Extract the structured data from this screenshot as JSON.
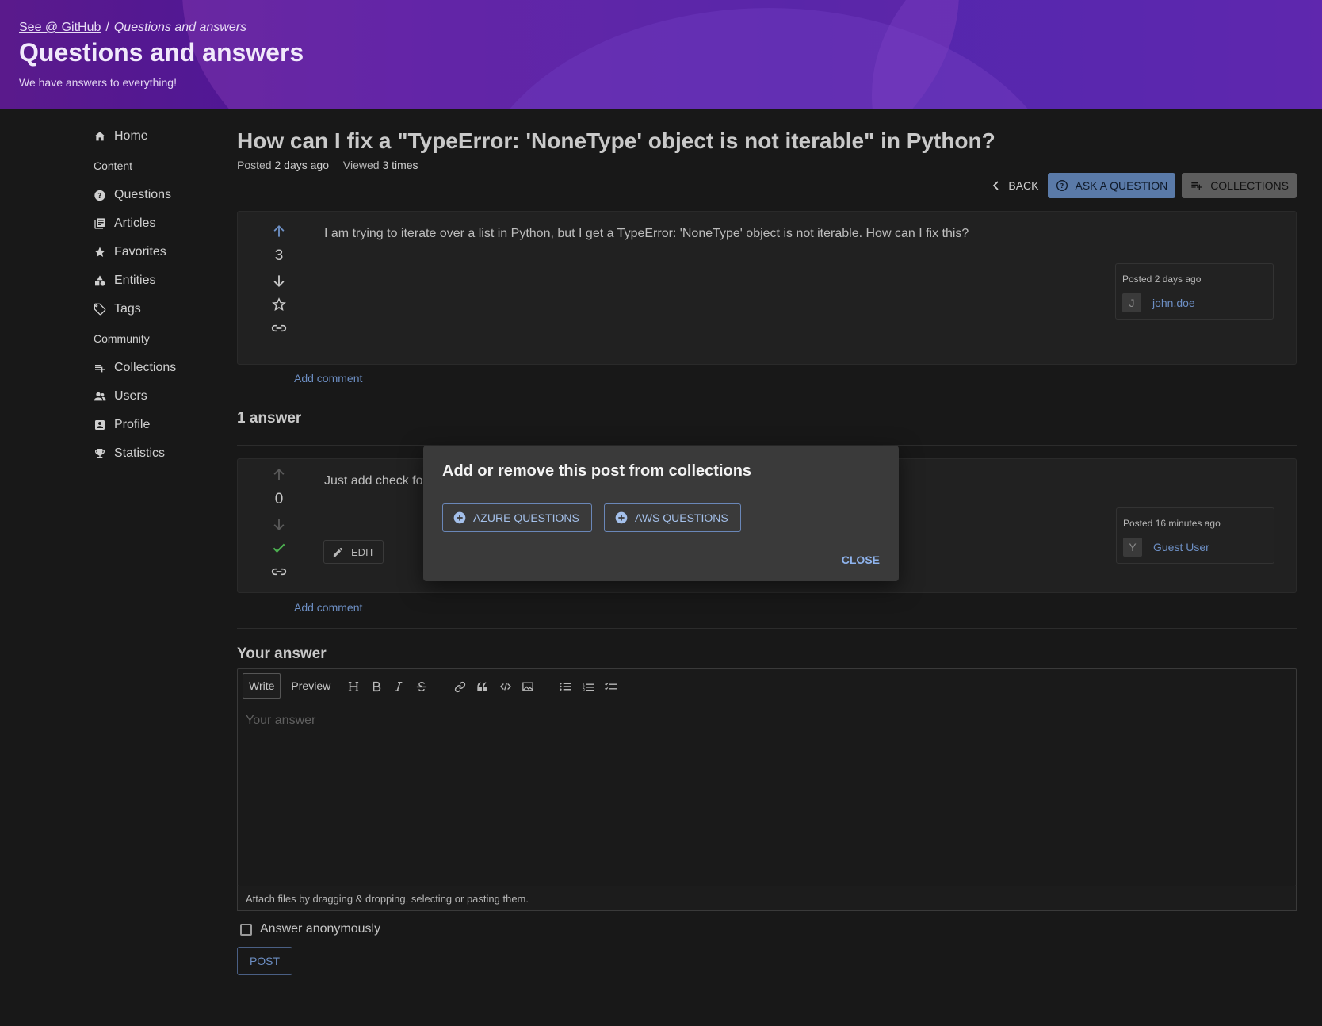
{
  "header": {
    "breadcrumb_link": "See @ GitHub",
    "breadcrumb_sep": "/",
    "breadcrumb_current": "Questions and answers",
    "title": "Questions and answers",
    "subtitle": "We have answers to everything!"
  },
  "sidebar": {
    "home": "Home",
    "content_heading": "Content",
    "content_items": [
      "Questions",
      "Articles",
      "Favorites",
      "Entities",
      "Tags"
    ],
    "community_heading": "Community",
    "community_items": [
      "Collections",
      "Users",
      "Profile",
      "Statistics"
    ]
  },
  "question": {
    "title": "How can I fix a \"TypeError: 'NoneType' object is not iterable\" in Python?",
    "posted_label": "Posted",
    "posted_value": "2 days ago",
    "viewed_label": "Viewed",
    "viewed_value": "3 times",
    "votes": "3",
    "body": "I am trying to iterate over a list in Python, but I get a TypeError: 'NoneType' object is not iterable. How can I fix this?",
    "author_posted": "Posted 2 days ago",
    "author_initial": "J",
    "author_name": "john.doe",
    "add_comment": "Add comment"
  },
  "actions": {
    "back": "BACK",
    "ask": "ASK A QUESTION",
    "collections": "COLLECTIONS"
  },
  "answers": {
    "count_label": "1 answer",
    "items": [
      {
        "votes": "0",
        "body": "Just add check fo",
        "edit": "EDIT",
        "author_posted": "Posted 16 minutes ago",
        "author_initial": "Y",
        "author_name": "Guest User",
        "add_comment": "Add comment"
      }
    ]
  },
  "your_answer": {
    "title": "Your answer",
    "tab_write": "Write",
    "tab_preview": "Preview",
    "placeholder": "Your answer",
    "attach_hint": "Attach files by dragging & dropping, selecting or pasting them.",
    "anonymous_label": "Answer anonymously",
    "post": "POST"
  },
  "modal": {
    "title": "Add or remove this post from collections",
    "collections": [
      "AZURE QUESTIONS",
      "AWS QUESTIONS"
    ],
    "close": "CLOSE"
  },
  "colors": {
    "accent_blue": "#6d8fc4",
    "header_purple": "#4a159b",
    "accepted_green": "#4caf50",
    "background": "#181818"
  }
}
